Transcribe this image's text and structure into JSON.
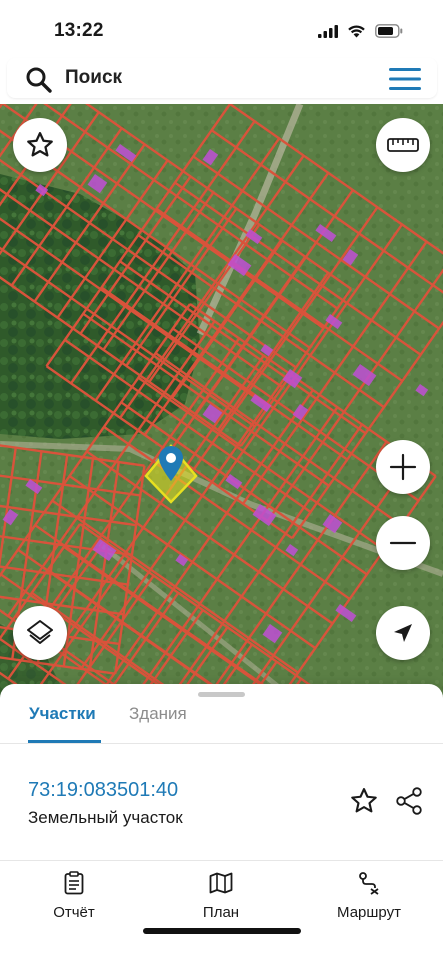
{
  "status_bar": {
    "time": "13:22",
    "icons": [
      "cellular-signal-icon",
      "wifi-icon",
      "battery-icon"
    ]
  },
  "search": {
    "placeholder": "Поиск",
    "icon": "search-icon",
    "menu_icon": "hamburger-menu-icon"
  },
  "map": {
    "controls": [
      "favorite-star-icon",
      "ruler-icon",
      "layers-icon",
      "zoom-in-icon",
      "zoom-out-icon",
      "locate-arrow-icon"
    ],
    "marker_icon": "location-pin-icon",
    "colors": {
      "parcel_lines": "#d9533b",
      "buildings": "#c04fd6",
      "selected_parcel": "#e8e020",
      "marker": "#1f7ab6"
    }
  },
  "sheet": {
    "tabs": [
      {
        "label": "Участки",
        "active": true
      },
      {
        "label": "Здания",
        "active": false
      }
    ],
    "parcel": {
      "number": "73:19:083501:40",
      "type": "Земельный участок"
    },
    "actions": [
      "star-outline-icon",
      "share-icon"
    ],
    "nav": [
      {
        "label": "Отчёт",
        "icon": "report-clipboard-icon"
      },
      {
        "label": "План",
        "icon": "map-plan-icon"
      },
      {
        "label": "Маршрут",
        "icon": "route-icon"
      }
    ],
    "accent_color": "#1f7ab6"
  }
}
